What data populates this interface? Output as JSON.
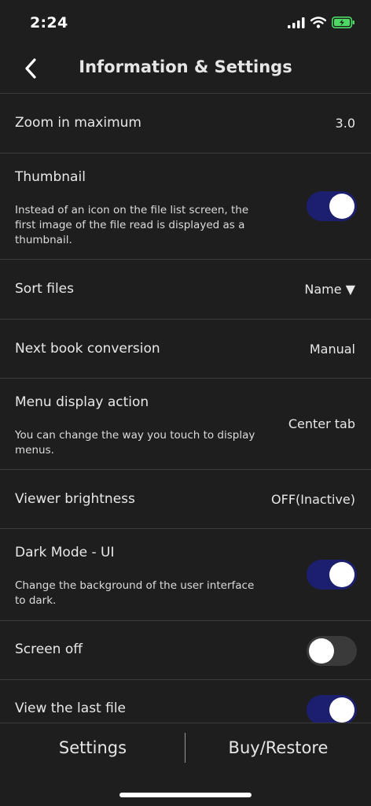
{
  "status": {
    "time": "2:24"
  },
  "nav": {
    "title": "Information & Settings"
  },
  "settings": {
    "zoom": {
      "label": "Zoom in maximum",
      "value": "3.0"
    },
    "thumbnail": {
      "label": "Thumbnail",
      "description": "Instead of an icon on the file list screen, the first image of the file read is displayed as a thumbnail.",
      "enabled": true
    },
    "sort": {
      "label": "Sort files",
      "value": "Name ▼"
    },
    "next_book": {
      "label": "Next book conversion",
      "value": "Manual"
    },
    "menu_display": {
      "label": "Menu display action",
      "description": "You can change the way you touch to display menus.",
      "value": "Center tab"
    },
    "brightness": {
      "label": "Viewer brightness",
      "value": "OFF(Inactive)"
    },
    "dark_mode": {
      "label": "Dark Mode - UI",
      "description": "Change the background of the user interface to dark.",
      "enabled": true
    },
    "screen_off": {
      "label": "Screen off",
      "enabled": false
    },
    "last_file": {
      "label": "View the last file",
      "enabled": true
    }
  },
  "tabs": {
    "settings": "Settings",
    "buy_restore": "Buy/Restore"
  },
  "colors": {
    "background": "#1e1e1e",
    "toggle_on": "#1c1f6e",
    "toggle_off": "#3a3a3a",
    "divider": "#3c3c3c",
    "battery": "#4cd964"
  },
  "icons": [
    "back-chevron-icon",
    "cellular-signal-icon",
    "wifi-icon",
    "battery-charging-icon"
  ]
}
